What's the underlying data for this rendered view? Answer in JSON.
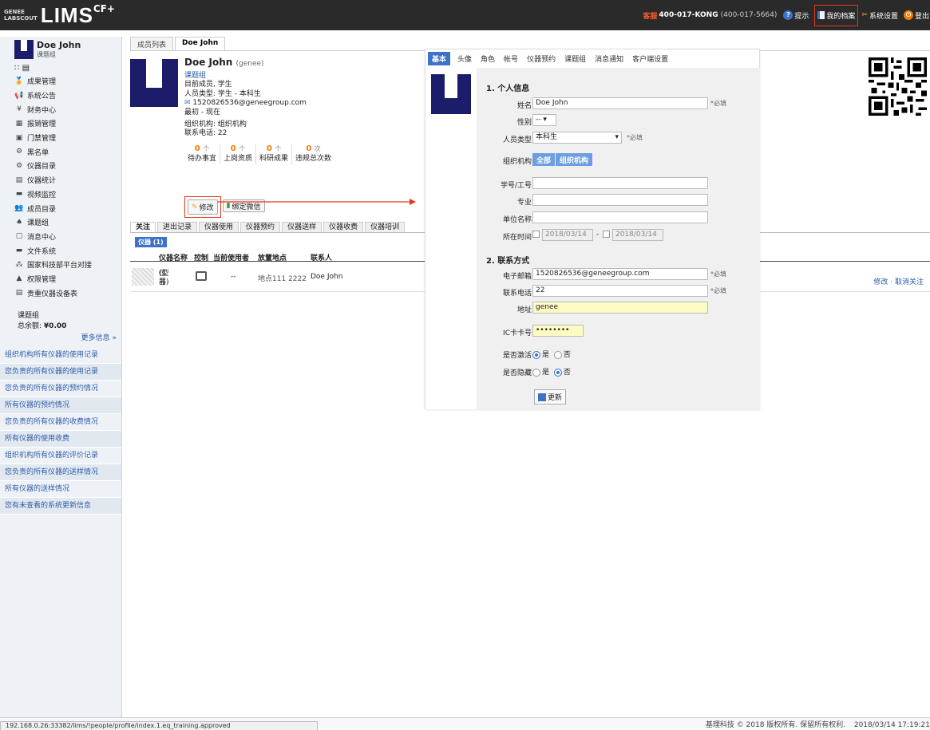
{
  "topbar": {
    "logo_small_1": "GENEE",
    "logo_small_2": "LABSCOUT",
    "logo_big": "LIMS",
    "logo_sup": "CF+",
    "service_label": "客服",
    "service_number": "400-017-KONG",
    "service_alt": "(400-017-5664)",
    "hint": "提示",
    "my_profile": "我的档案",
    "settings": "系统设置",
    "logout": "登出",
    "colors": {
      "bg": "#2a2a2a",
      "accent": "#ff5b31",
      "highlight_box": "#e03a1e"
    }
  },
  "sidebar": {
    "user_name": "Doe John",
    "user_group": "课题组",
    "menu": [
      {
        "icon": "medal-icon",
        "glyph": "🏅",
        "label": "成果管理"
      },
      {
        "icon": "megaphone-icon",
        "glyph": "📢",
        "label": "系统公告"
      },
      {
        "icon": "yen-icon",
        "glyph": "¥",
        "label": "财务中心"
      },
      {
        "icon": "calculator-icon",
        "glyph": "▦",
        "label": "报销管理"
      },
      {
        "icon": "door-icon",
        "glyph": "▣",
        "label": "门禁管理"
      },
      {
        "icon": "gear-list-icon",
        "glyph": "⚙",
        "label": "黑名单"
      },
      {
        "icon": "gear-icon",
        "glyph": "⚙",
        "label": "仪器目录"
      },
      {
        "icon": "chart-icon",
        "glyph": "▤",
        "label": "仪器统计"
      },
      {
        "icon": "camera-icon",
        "glyph": "▬",
        "label": "视频监控"
      },
      {
        "icon": "people-icon",
        "glyph": "👥",
        "label": "成员目录"
      },
      {
        "icon": "tree-icon",
        "glyph": "♠",
        "label": "课题组"
      },
      {
        "icon": "chat-icon",
        "glyph": "▢",
        "label": "消息中心"
      },
      {
        "icon": "folder-icon",
        "glyph": "▬",
        "label": "文件系统"
      },
      {
        "icon": "network-icon",
        "glyph": "⁂",
        "label": "国家科技部平台对接"
      },
      {
        "icon": "warning-icon",
        "glyph": "▲",
        "label": "权限管理"
      },
      {
        "icon": "table-icon",
        "glyph": "▤",
        "label": "贵重仪器设备表"
      }
    ],
    "group_name": "课题组",
    "balance_label": "总余额:",
    "balance_value": "¥0.00",
    "more_info": "更多信息 »",
    "stat_links": [
      "组织机构所有仪器的使用记录",
      "您负责的所有仪器的使用记录",
      "您负责的所有仪器的预约情况",
      "所有仪器的预约情况",
      "您负责的所有仪器的收费情况",
      "所有仪器的使用收费",
      "组织机构所有仪器的评价记录",
      "您负责的所有仪器的送样情况",
      "所有仪器的送样情况",
      "您有未查看的系统更新信息"
    ]
  },
  "main": {
    "tabs": [
      "成员列表",
      "Doe John"
    ],
    "person": {
      "name": "Doe John",
      "login": "(genee)",
      "group": "课题组",
      "status": "目前成员, 学生",
      "type": "人员类型: 学生 - 本科生",
      "email": "1520826536@geneegroup.com",
      "period": "最初 - 现在",
      "org": "组织机构: 组织机构",
      "phone": "联系电话: 22"
    },
    "stats": [
      {
        "num": "0",
        "unit": "个",
        "label": "待办事宜"
      },
      {
        "num": "0",
        "unit": "个",
        "label": "上岗资质"
      },
      {
        "num": "0",
        "unit": "个",
        "label": "科研成果"
      },
      {
        "num": "0",
        "unit": "次",
        "label": "违规总次数"
      }
    ],
    "edit_btn": "修改",
    "wechat_btn": "绑定微信",
    "subtabs": [
      "关注",
      "进出记录",
      "仪器使用",
      "仪器预约",
      "仪器送样",
      "仪器收费",
      "仪器培训"
    ],
    "badge": "仪器 (1)",
    "table_headers": [
      "仪器名称",
      "控制",
      "当前使用者",
      "放置地点",
      "联系人"
    ],
    "table_row": {
      "name_1": "仪器",
      "name_2": "(型号)",
      "current_user": "--",
      "location": "地点111 2222",
      "contact": "Doe John",
      "actions": "修改 · 取消关注"
    }
  },
  "form": {
    "tabs": [
      "基本",
      "头像",
      "角色",
      "帐号",
      "仪器预约",
      "课题组",
      "消息通知",
      "客户端设置"
    ],
    "section1": "1. 个人信息",
    "section2": "2. 联系方式",
    "required": "*必填",
    "labels": {
      "name": "姓名",
      "gender": "性别",
      "type": "人员类型",
      "org": "组织机构",
      "id": "学号/工号",
      "major": "专业",
      "unit": "单位名称",
      "time": "所在时间",
      "email": "电子邮箱",
      "phone": "联系电话",
      "address": "地址",
      "ic": "IC卡卡号",
      "active": "是否激活",
      "hidden": "是否隐藏"
    },
    "values": {
      "name": "Doe John",
      "gender": "--",
      "type": "本科生",
      "org_all": "全部",
      "org_node": "组织机构",
      "date_from": "2018/03/14",
      "date_to": "2018/03/14",
      "email": "1520826536@geneegroup.com",
      "phone": "22",
      "address": "genee",
      "ic": "••••••••"
    },
    "yes": "是",
    "no": "否",
    "save": "更新"
  },
  "footer": {
    "url": "192.168.0.26:33382/lims/!people/profile/index.1.eq_training.approved",
    "copyright": "基理科技 © 2018 版权所有. 保留所有权利.",
    "datetime": "2018/03/14 17:19:21"
  }
}
